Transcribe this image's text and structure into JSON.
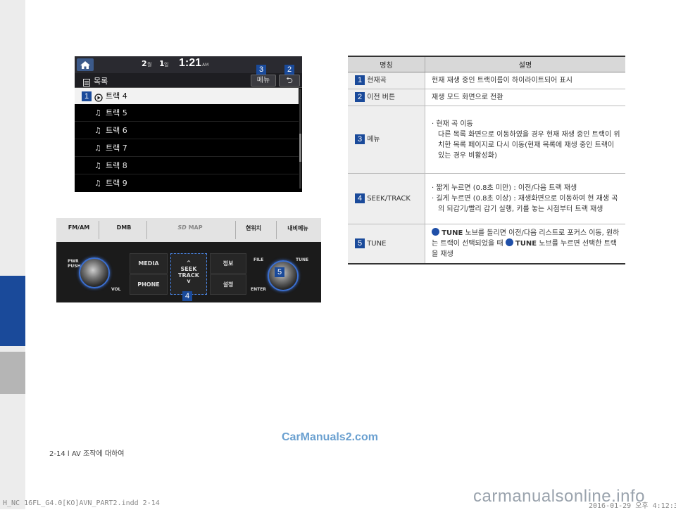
{
  "screen": {
    "date_month": "2",
    "date_month_unit": "월",
    "date_day": "1",
    "date_day_unit": "일",
    "time": "1:21",
    "ampm": "AM",
    "list_title": "목록",
    "menu_btn": "메뉴",
    "back_symbol": "⮌",
    "tracks": [
      "트랙 4",
      "트랙 5",
      "트랙 6",
      "트랙 7",
      "트랙 8",
      "트랙 9"
    ]
  },
  "callouts": {
    "one": "1",
    "two": "2",
    "three": "3",
    "four": "4",
    "five": "5"
  },
  "panel": {
    "tabs": [
      "FM/AM",
      "DMB",
      "MAP",
      "현위치",
      "내비메뉴"
    ],
    "pwr_push": "PWR\nPUSH",
    "vol": "VOL",
    "media": "MEDIA",
    "phone": "PHONE",
    "seek_track": "SEEK\nTRACK",
    "info": "정보",
    "settings": "설정",
    "file": "FILE",
    "tune": "TUNE",
    "enter": "ENTER"
  },
  "table": {
    "headers": [
      "명칭",
      "설명"
    ],
    "rows": [
      {
        "num": "1",
        "name": "현재곡",
        "desc": "현재 재생 중인 트랙이름이 하이라이트되어 표시"
      },
      {
        "num": "2",
        "name": "이전 버튼",
        "desc": "재생 모드 화면으로 전환"
      },
      {
        "num": "3",
        "name": "메뉴",
        "bullet": "현재 곡 이동",
        "desc2": "다른 목록 화면으로 이동하였을 경우 현재 재생 중인 트랙이 위치한 목록 페이지로 다시 이동(현재 목록에 재생 중인 트랙이 있는 경우 비활성화)"
      },
      {
        "num": "4",
        "name": "SEEK/TRACK",
        "bullets": [
          "짧게 누르면 (0.8초 미만) : 이전/다음 트랙 재생",
          "길게 누르면 (0.8초 이상) : 재생화면으로 이동하여 현 재생 곡의 되감기/빨리 감기 실행, 키를 놓는 시점부터 트랙 재생"
        ]
      },
      {
        "num": "5",
        "name": "TUNE",
        "tune_label": "TUNE",
        "tune_text_1": "노브를 돌리면 이전/다음 리스트로 포커스 이동, 원하는 트랙이 선택되었을 때",
        "tune_label_2": "TUNE",
        "tune_text_2": "노브를 누르면 선택한 트랙을 재생"
      }
    ]
  },
  "footer": "2-14 l AV 조작에 대하여",
  "watermark_top": "CarManuals2.com",
  "print_left": "H_NC 16FL_G4.0[KO]AVN_PART2.indd   2-14",
  "print_right": "2016-01-29   오후 4:12:3",
  "watermark_bottom": "carmanualsonline.info",
  "colors": {
    "accent": "#1a4a9a",
    "sidebar_blue": "#1a4a9a",
    "sidebar_gray": "#b5b5b5"
  }
}
